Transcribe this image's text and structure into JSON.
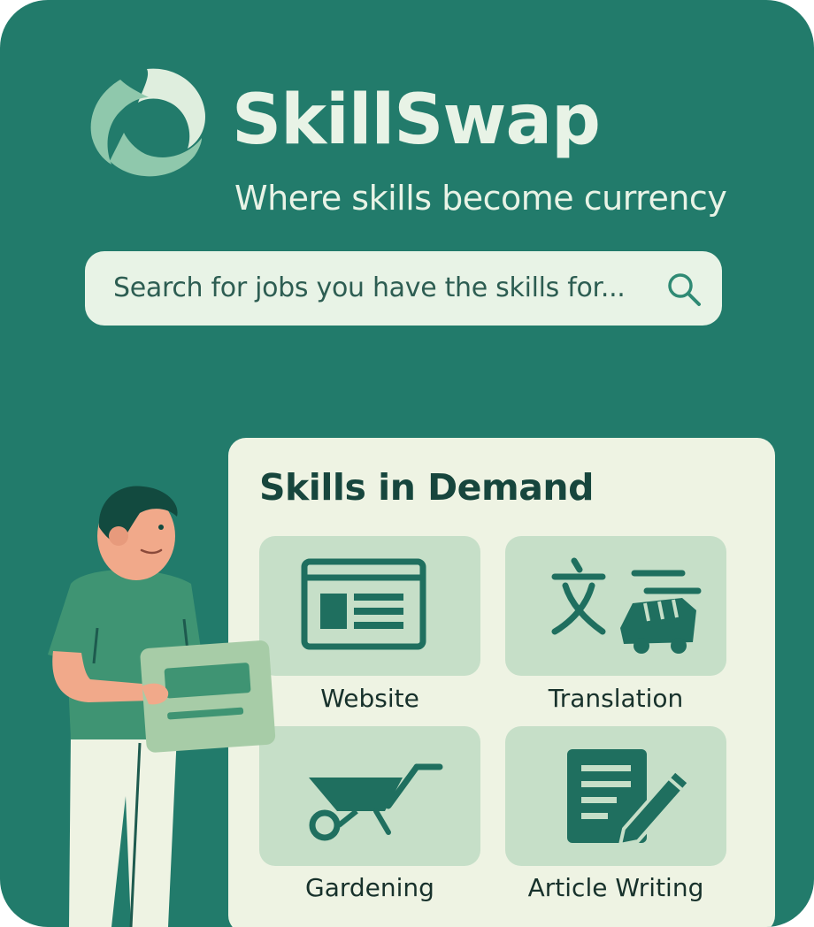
{
  "brand": {
    "name": "SkillSwap",
    "tagline": "Where skills become currency",
    "logo_icon": "swirl-logo-icon"
  },
  "search": {
    "placeholder": "Search for jobs you have the skills for...",
    "icon": "search-icon"
  },
  "panel": {
    "title": "Skills in Demand",
    "skills": [
      {
        "label": "Website",
        "icon": "website-icon"
      },
      {
        "label": "Translation",
        "icon": "translation-icon"
      },
      {
        "label": "Gardening",
        "icon": "wheelbarrow-icon"
      },
      {
        "label": "Article Writing",
        "icon": "document-pencil-icon"
      }
    ]
  },
  "colors": {
    "background": "#227b6b",
    "light": "#e8f3e6",
    "panel": "#eef3e3",
    "tile": "#c6dfc8",
    "icon": "#1f6f5f",
    "dark_text": "#17463d"
  }
}
